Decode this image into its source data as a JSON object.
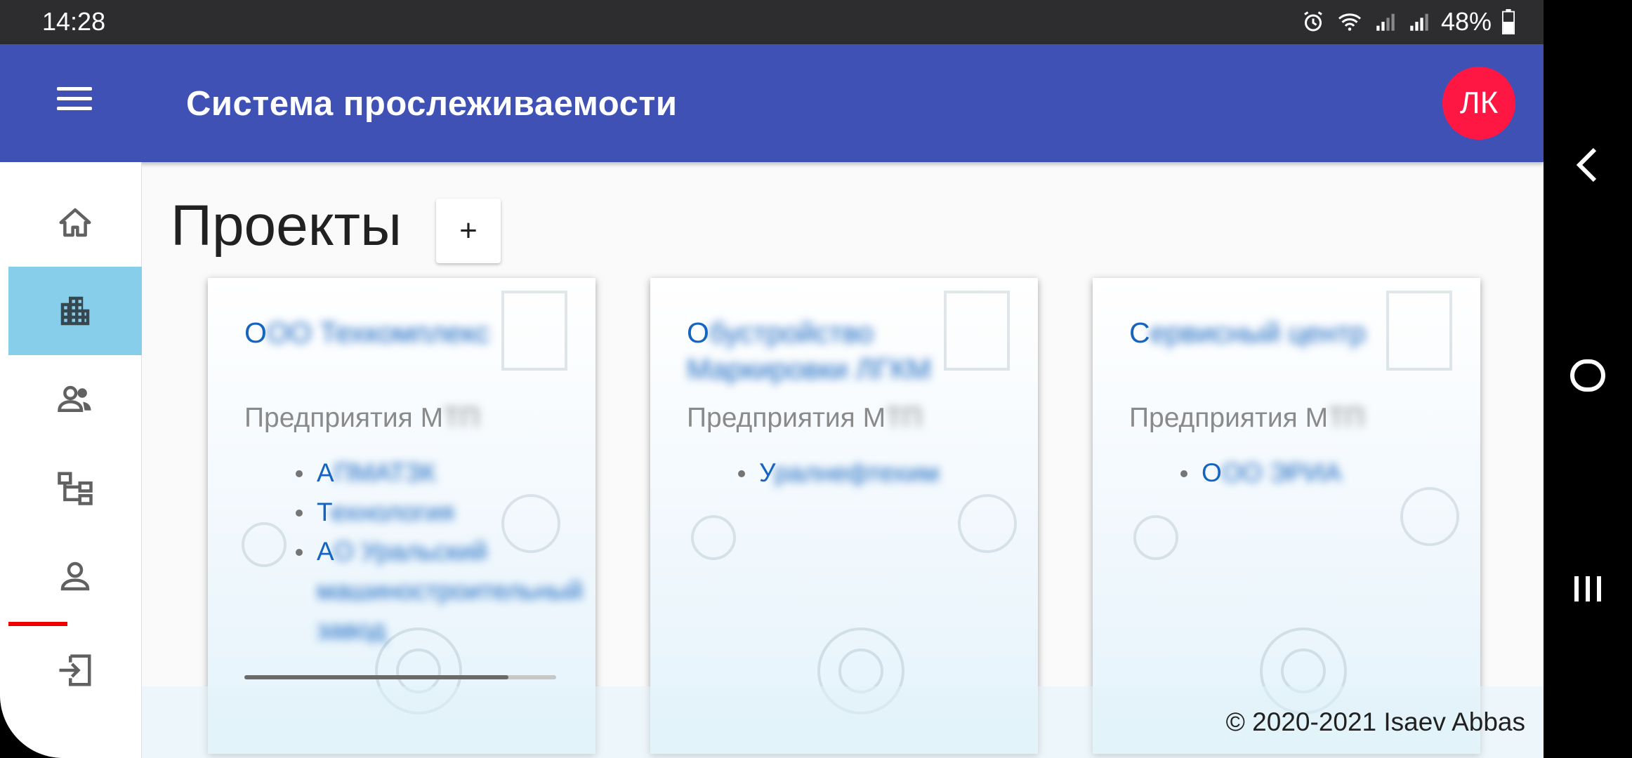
{
  "status_bar": {
    "time": "14:28",
    "battery": "48%"
  },
  "app_bar": {
    "title": "Система прослеживаемости",
    "avatar_initials": "ЛК"
  },
  "sidebar": {
    "items": [
      {
        "icon": "home-icon"
      },
      {
        "icon": "business-icon",
        "active": true
      },
      {
        "icon": "people-icon"
      },
      {
        "icon": "hierarchy-icon"
      },
      {
        "icon": "person-icon"
      },
      {
        "icon": "login-icon"
      }
    ]
  },
  "page": {
    "title": "Проекты",
    "add_label": "+"
  },
  "cards": [
    {
      "name_visible": "О",
      "name_blurred": "ОО Техкомплекс",
      "org_visible": "Предприятия М",
      "org_blurred": "ТП",
      "items": [
        {
          "visible": "А",
          "blurred": "ПМАТЗК"
        },
        {
          "visible": "Т",
          "blurred": "ехнология"
        },
        {
          "visible": "А",
          "blurred": "О Уральский машиностроительный завод"
        }
      ]
    },
    {
      "name_visible": "О",
      "name_blurred": "бустройство Маркировки ЛГКМ",
      "org_visible": "Предприятия М",
      "org_blurred": "ТП",
      "items": [
        {
          "visible": "У",
          "blurred": "ралнефтехим"
        }
      ]
    },
    {
      "name_visible": "С",
      "name_blurred": "ервисный центр",
      "org_visible": "Предприятия М",
      "org_blurred": "ТП",
      "items": [
        {
          "visible": "О",
          "blurred": "ОО ЭРИА"
        }
      ]
    }
  ],
  "footer": {
    "text": "© 2020-2021 Isaev Abbas"
  },
  "colors": {
    "primary": "#3f51b5",
    "avatar": "#ff1744",
    "active_nav": "#87ceeb",
    "link": "#1565c0"
  },
  "android_nav": {
    "icons": [
      "back-icon",
      "home-circle-icon",
      "recents-icon"
    ]
  }
}
